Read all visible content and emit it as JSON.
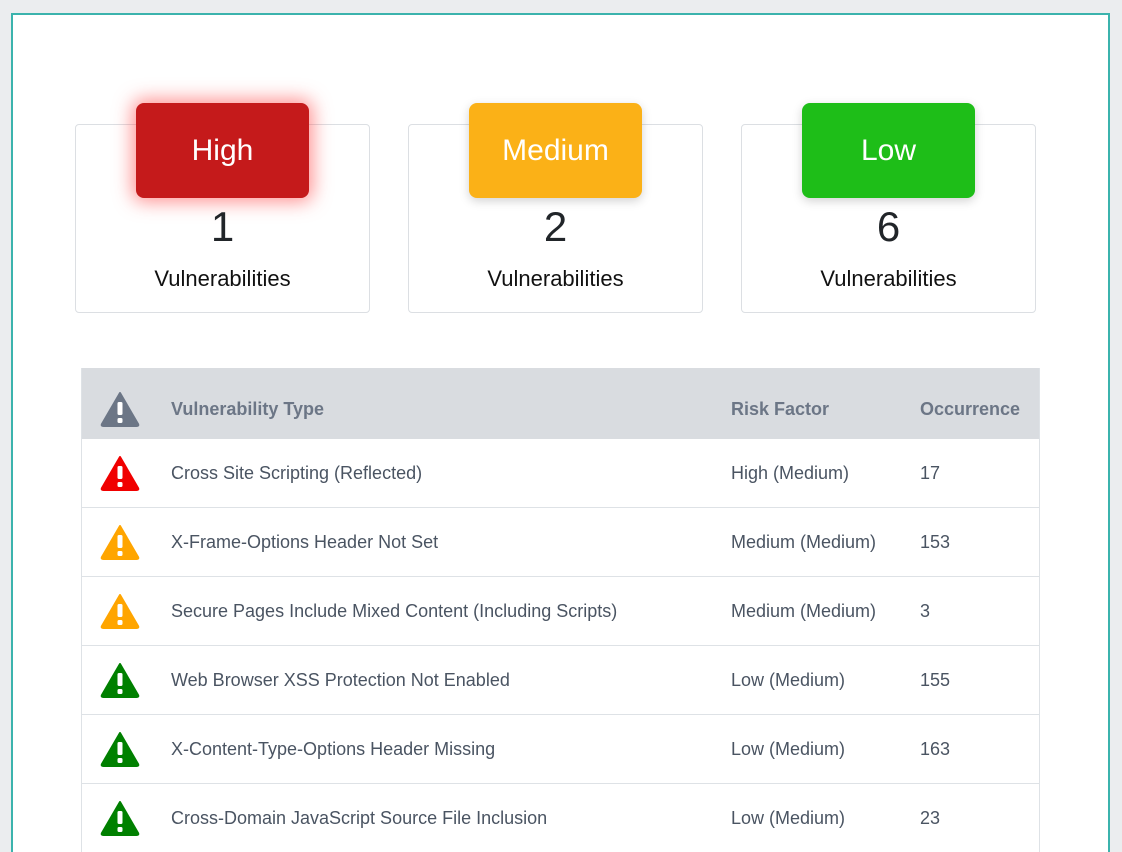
{
  "summary": [
    {
      "level": "High",
      "count": "1",
      "label": "Vulnerabilities",
      "color": "#c51a1b"
    },
    {
      "level": "Medium",
      "count": "2",
      "label": "Vulnerabilities",
      "color": "#fbb117"
    },
    {
      "level": "Low",
      "count": "6",
      "label": "Vulnerabilities",
      "color": "#1ebe18"
    }
  ],
  "table": {
    "header_icon": "warning-icon",
    "columns": [
      "Vulnerability Type",
      "Risk Factor",
      "Occurrence"
    ],
    "rows": [
      {
        "severity": "high",
        "icon_color": "#f00000",
        "type": "Cross Site Scripting (Reflected)",
        "risk": "High (Medium)",
        "occurrence": "17"
      },
      {
        "severity": "medium",
        "icon_color": "#ffa500",
        "type": "X-Frame-Options Header Not Set",
        "risk": "Medium (Medium)",
        "occurrence": "153"
      },
      {
        "severity": "medium",
        "icon_color": "#ffa500",
        "type": "Secure Pages Include Mixed Content (Including Scripts)",
        "risk": "Medium (Medium)",
        "occurrence": "3"
      },
      {
        "severity": "low",
        "icon_color": "#008000",
        "type": "Web Browser XSS Protection Not Enabled",
        "risk": "Low (Medium)",
        "occurrence": "155"
      },
      {
        "severity": "low",
        "icon_color": "#008000",
        "type": "X-Content-Type-Options Header Missing",
        "risk": "Low (Medium)",
        "occurrence": "163"
      },
      {
        "severity": "low",
        "icon_color": "#008000",
        "type": "Cross-Domain JavaScript Source File Inclusion",
        "risk": "Low (Medium)",
        "occurrence": "23"
      }
    ]
  }
}
